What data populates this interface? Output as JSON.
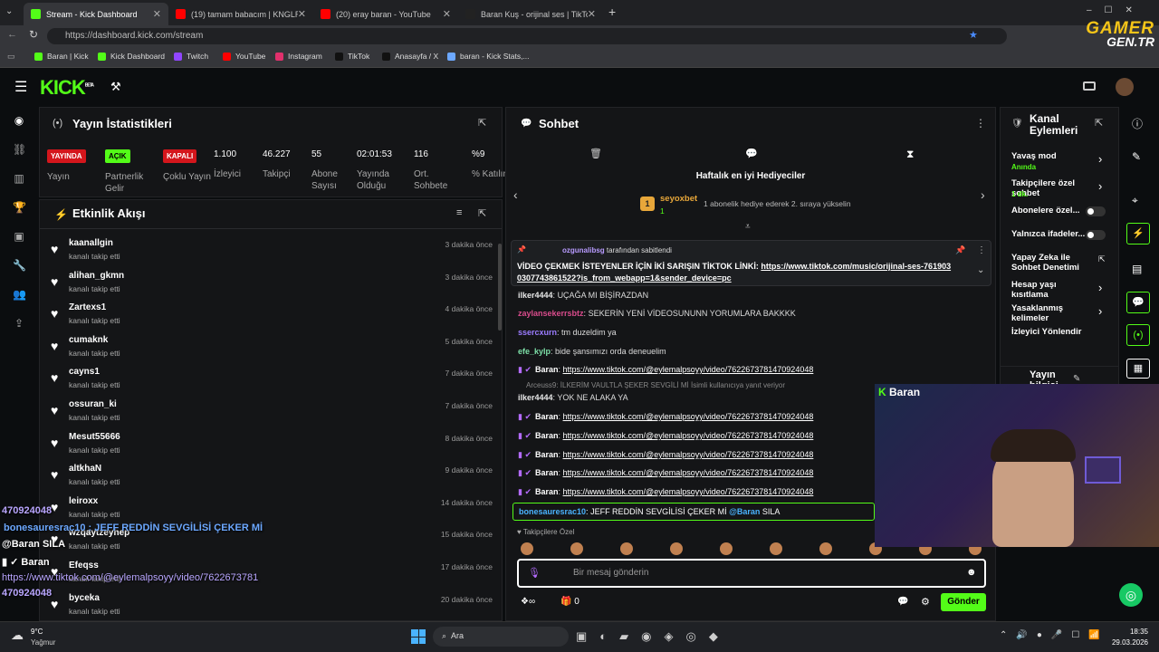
{
  "browser": {
    "tabs": [
      {
        "label": "Stream - Kick Dashboard",
        "color": "#53fc18"
      },
      {
        "label": "(19) tamam babacım | KNGLRP - Y",
        "color": "#ff0000"
      },
      {
        "label": "(20) eray baran - YouTube",
        "color": "#ff0000"
      },
      {
        "label": "Baran Kuş - orijinal ses | TikTok",
        "color": "#222222"
      }
    ],
    "url": "https://dashboard.kick.com/stream",
    "bookmarks": [
      "Baran | Kick",
      "Kick Dashboard",
      "Twitch",
      "YouTube",
      "Instagram",
      "TikTok",
      "Anasayfa / X",
      "baran - Kick Stats,..."
    ]
  },
  "watermark": {
    "line1": "GAMER",
    "line2": "GEN.TR"
  },
  "logo": {
    "text": "KICK",
    "beta": "BETA"
  },
  "stats": {
    "title": "Yayın İstatistikleri",
    "badges": [
      {
        "text": "YAYINDA",
        "label": "Yayın",
        "color": "#d4161c"
      },
      {
        "text": "AÇIK",
        "label": "Partnerlik Gelir",
        "color": "#53fc18"
      },
      {
        "text": "KAPALI",
        "label": "Çoklu Yayın",
        "color": "#d4161c"
      }
    ],
    "items": [
      {
        "value": "1.100",
        "label": "İzleyici"
      },
      {
        "value": "46.227",
        "label": "Takipçi"
      },
      {
        "value": "55",
        "label": "Abone Sayısı"
      },
      {
        "value": "02:01:53",
        "label": "Yayında Olduğu"
      },
      {
        "value": "116",
        "label": "Ort. Sohbete"
      },
      {
        "value": "%9",
        "label": "% Katılım"
      }
    ]
  },
  "activity": {
    "title": "Etkinlik Akışı",
    "subtitle": "kanalı takip etti",
    "events": [
      {
        "name": "kaanallgin",
        "time": "3 dakika önce"
      },
      {
        "name": "alihan_gkmn",
        "time": "3 dakika önce"
      },
      {
        "name": "Zartexs1",
        "time": "4 dakika önce"
      },
      {
        "name": "cumaknk",
        "time": "5 dakika önce"
      },
      {
        "name": "cayns1",
        "time": "7 dakika önce"
      },
      {
        "name": "ossuran_ki",
        "time": "7 dakika önce"
      },
      {
        "name": "Mesut55666",
        "time": "8 dakika önce"
      },
      {
        "name": "altkhaN",
        "time": "9 dakika önce"
      },
      {
        "name": "leiroxx",
        "time": "14 dakika önce"
      },
      {
        "name": "wzqaytzeyhep",
        "time": "15 dakika önce"
      },
      {
        "name": "Efeqss",
        "time": "17 dakika önce"
      },
      {
        "name": "byceka",
        "time": "20 dakika önce"
      }
    ]
  },
  "chat": {
    "title": "Sohbet",
    "gifters_title": "Haftalık en iyi Hediyeciler",
    "top_gifter": "seyoxbet",
    "top_gifter_count": "1",
    "gifter_hint": "1 abonelik hediye ederek 2. sıraya yükselin",
    "pinned_by": "ozgunalibsg",
    "pinned_suffix": "tarafından sabitlendi",
    "pinned_text": "VİDEO ÇEKMEK İSTEYENLER İÇİN İKİ SARIŞIN TİKTOK LİNKİ: ",
    "pinned_link": "https://www.tiktok.com/music/orijinal-ses-7619030307743861522?is_from_webapp=1&sender_device=pc",
    "messages": [
      {
        "user": "ilker4444",
        "color": "#e8e8e8",
        "text": "UÇAĞA MI BİŞİRAZDAN",
        "link": ""
      },
      {
        "user": "zaylansekerrsbtz",
        "color": "#d94c8c",
        "text": "SEKERİN YENİ VİDEOSUNUNN YORUMLARA BAKKKK",
        "link": ""
      },
      {
        "user": "ssercxurn",
        "color": "#9b7cff",
        "text": "tm duzeldim ya",
        "link": ""
      },
      {
        "user": "efe_kylp",
        "color": "#7de0a8",
        "text": "bide şansımızı orda deneuelim",
        "link": ""
      },
      {
        "user": "Baran",
        "color": "#ffffff",
        "text": "",
        "link": "https://www.tiktok.com/@eylemalpsoyy/video/7622673781470924048"
      },
      {
        "user": "ilker4444",
        "color": "#e8e8e8",
        "text": "YOK NE ALAKA YA",
        "link": ""
      },
      {
        "user": "Baran",
        "color": "#ffffff",
        "text": "",
        "link": "https://www.tiktok.com/@eylemalpsoyy/video/7622673781470924048"
      },
      {
        "user": "Baran",
        "color": "#ffffff",
        "text": "",
        "link": "https://www.tiktok.com/@eylemalpsoyy/video/7622673781470924048"
      },
      {
        "user": "Baran",
        "color": "#ffffff",
        "text": "",
        "link": "https://www.tiktok.com/@eylemalpsoyy/video/7622673781470924048"
      },
      {
        "user": "Baran",
        "color": "#ffffff",
        "text": "",
        "link": "https://www.tiktok.com/@eylemalpsoyy/video/7622673781470924048"
      },
      {
        "user": "Baran",
        "color": "#ffffff",
        "text": "",
        "link": "https://www.tiktok.com/@eylemalpsoyy/video/7622673781470924048"
      }
    ],
    "reply_hint": "Arceuss9: İLKERİM VAULTLA ŞEKER SEVGİLİ Mİ İsimli kullanıcıya yanıt veriyor",
    "highlight_user": "bonesauresrac10",
    "highlight_text": "JEFF REDDİN SEVGİLİSİ ÇEKER Mİ",
    "highlight_mention": "@Baran",
    "highlight_tail": "SILA",
    "followers_only": "Takipçilere Özel",
    "placeholder": "Bir mesaj gönderin",
    "points": "0",
    "send": "Gönder"
  },
  "actions": {
    "title": "Kanal Eylemleri",
    "items": [
      {
        "label": "Yavaş mod",
        "sub": "Anında",
        "kind": "arrow"
      },
      {
        "label": "Takipçilere özel sohbet",
        "sub": "1 dk.",
        "kind": "arrow"
      },
      {
        "label": "Abonelere özel...",
        "sub": "",
        "kind": "toggle"
      },
      {
        "label": "Yalnızca ifadeler...",
        "sub": "",
        "kind": "toggle"
      },
      {
        "label": "Yapay Zeka ile Sohbet Denetimi",
        "sub": "",
        "kind": "link"
      },
      {
        "label": "Hesap yaşı kısıtlama",
        "sub": "",
        "kind": "arrow"
      },
      {
        "label": "Yasaklanmış kelimeler",
        "sub": "",
        "kind": "arrow"
      },
      {
        "label": "İzleyici Yönlendir",
        "sub": "",
        "kind": "none"
      }
    ],
    "info_title": "Yayın bilgisi"
  },
  "webcam": {
    "name": "Baran"
  },
  "overlay": {
    "lines": [
      "470924048",
      "bonesauresrac10 : JEFF REDDİN SEVGİLİSİ ÇEKER Mİ",
      "@Baran SILA",
      "Baran",
      "https://www.tiktok.com/@eylemalpsoyy/video/7622673781",
      "470924048",
      "673781"
    ]
  },
  "taskbar": {
    "temp": "9°C",
    "weather": "Yağmur",
    "search": "Ara",
    "time": "18:35",
    "date": "29.03.2026"
  }
}
